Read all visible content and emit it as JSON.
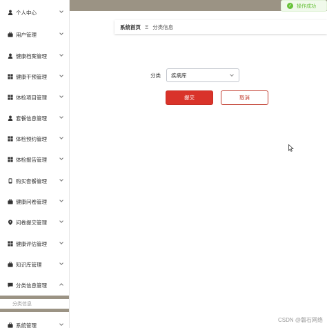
{
  "toast": {
    "text": "操作成功",
    "icon": "check-circle-icon",
    "color": "#67c23a"
  },
  "sidebar": {
    "items": [
      {
        "label": "个人中心",
        "icon": "person-icon"
      },
      {
        "label": "用户管理",
        "icon": "briefcase-icon"
      },
      {
        "label": "健康档案管理",
        "icon": "person-icon"
      },
      {
        "label": "健康干预管理",
        "icon": "grid-icon"
      },
      {
        "label": "体检项目管理",
        "icon": "grid-icon"
      },
      {
        "label": "套餐信息管理",
        "icon": "person-icon"
      },
      {
        "label": "体检预约管理",
        "icon": "grid-icon"
      },
      {
        "label": "体检报告管理",
        "icon": "grid-icon"
      },
      {
        "label": "购买套餐管理",
        "icon": "phone-icon"
      },
      {
        "label": "健康问卷管理",
        "icon": "briefcase-icon"
      },
      {
        "label": "问卷提交管理",
        "icon": "location-icon"
      },
      {
        "label": "健康评估管理",
        "icon": "grid-icon"
      },
      {
        "label": "知识库管理",
        "icon": "briefcase-icon"
      },
      {
        "label": "分类信息管理",
        "icon": "chat-icon",
        "expanded": true
      }
    ],
    "submenu_label": "分类信息",
    "last_item": {
      "label": "系统管理",
      "icon": "briefcase-icon"
    }
  },
  "breadcrumb": {
    "home": "系统首页",
    "separator": "Ξ",
    "current": "分类信息"
  },
  "form": {
    "label": "分类",
    "select_value": "疾病库",
    "submit_label": "提交",
    "cancel_label": "取消"
  },
  "watermark": "CSDN @磐石网络",
  "colors": {
    "accent": "#d9332a",
    "topbar": "#9b9384"
  }
}
